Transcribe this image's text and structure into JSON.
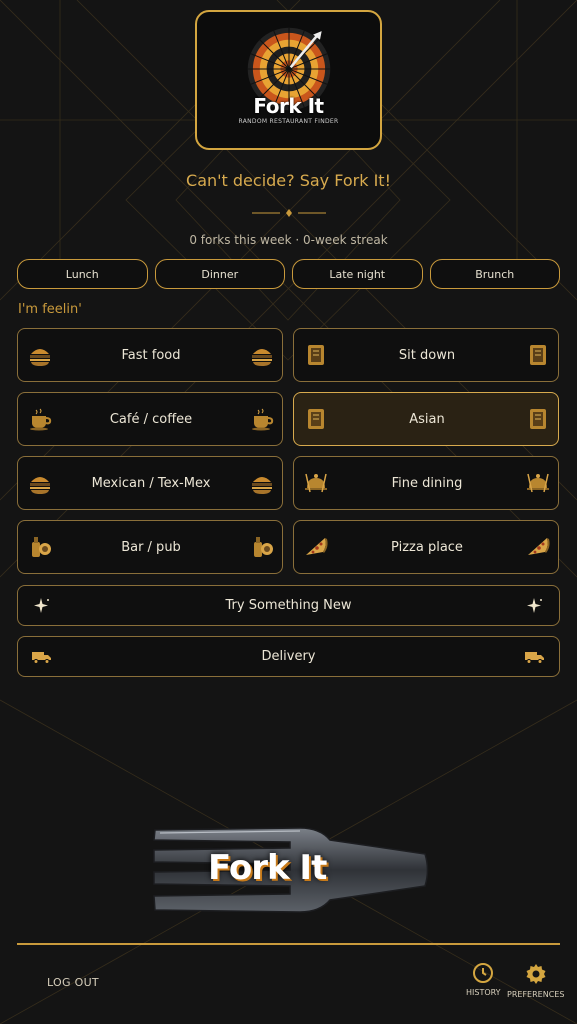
{
  "logo": {
    "title": "Fork It",
    "subtitle": "RANDOM RESTAURANT FINDER"
  },
  "tagline": "Can't decide? Say Fork It!",
  "stats": {
    "forks": "0 forks this week",
    "separator": "·",
    "streak": "0-week streak"
  },
  "meal_times": [
    {
      "label": "Lunch"
    },
    {
      "label": "Dinner"
    },
    {
      "label": "Late night"
    },
    {
      "label": "Brunch"
    }
  ],
  "feelin_label": "I'm feelin'",
  "categories": [
    {
      "label": "Fast food",
      "icon": "burger-icon",
      "active": false
    },
    {
      "label": "Sit down",
      "icon": "menu-book-icon",
      "active": false
    },
    {
      "label": "Café / coffee",
      "icon": "coffee-cup-icon",
      "active": false
    },
    {
      "label": "Asian",
      "icon": "menu-book-icon",
      "active": true
    },
    {
      "label": "Mexican / Tex-Mex",
      "icon": "burger-icon",
      "active": false
    },
    {
      "label": "Fine dining",
      "icon": "cloche-icon",
      "active": false
    },
    {
      "label": "Bar / pub",
      "icon": "bottle-icon",
      "active": false
    },
    {
      "label": "Pizza place",
      "icon": "pizza-slice-icon",
      "active": false
    }
  ],
  "try_new": {
    "label": "Try Something New",
    "icon": "sparkle-icon"
  },
  "delivery": {
    "label": "Delivery",
    "icon": "truck-icon"
  },
  "fork_button": {
    "label": "Fork It"
  },
  "footer": {
    "logout": "LOG OUT",
    "history": "HISTORY",
    "preferences": "PREFERENCES"
  },
  "colors": {
    "accent": "#d4a640",
    "background": "#141414",
    "active_bg": "#2a2214"
  }
}
